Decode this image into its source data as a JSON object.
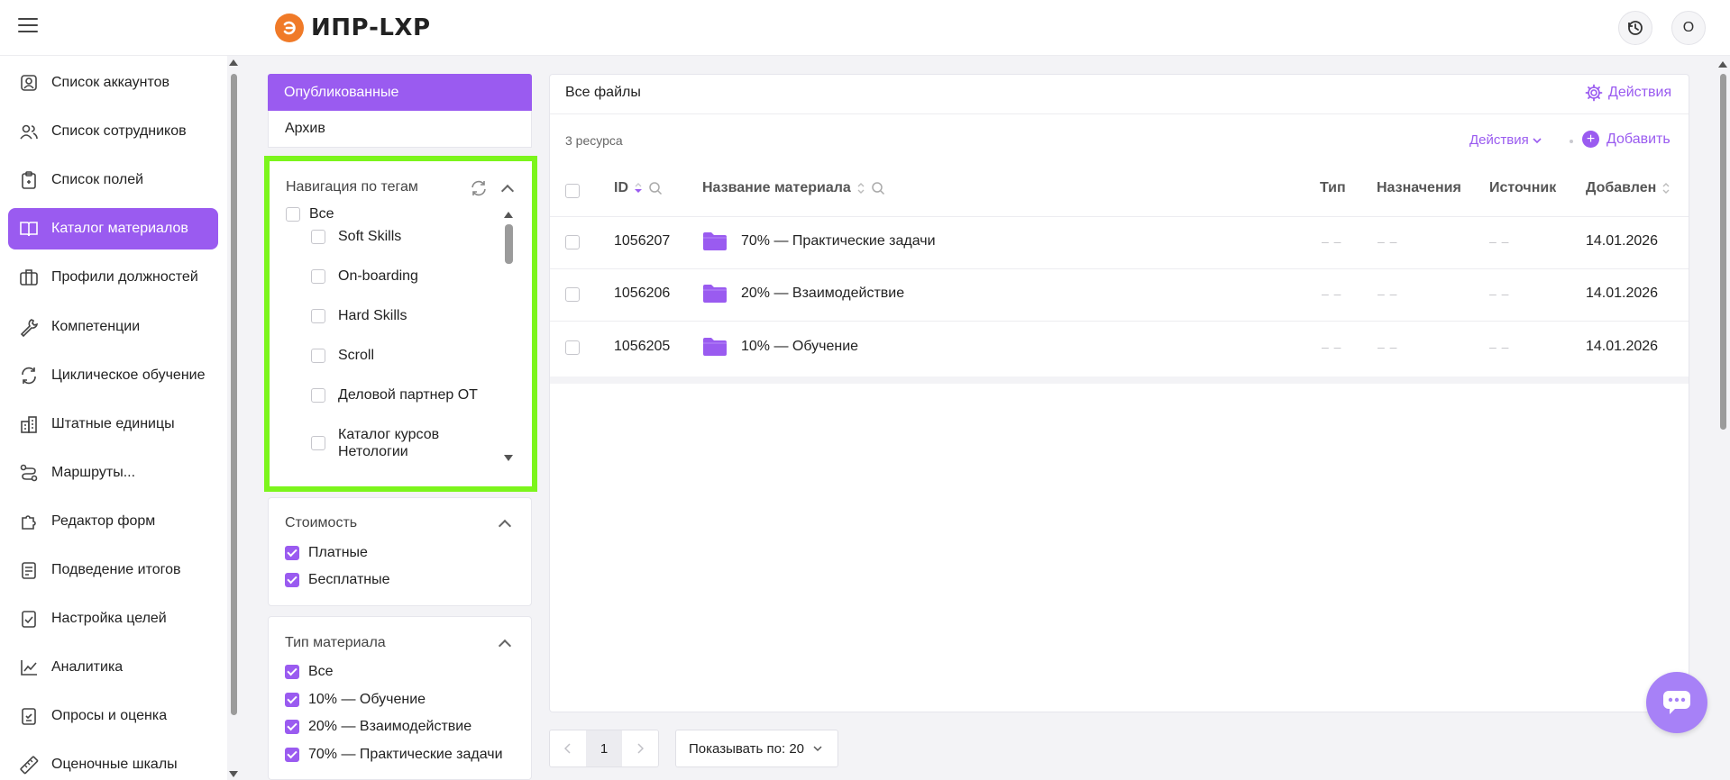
{
  "app": {
    "logo_text": "ИПР-LXP",
    "user_initial": "О"
  },
  "sidebar": {
    "items": [
      {
        "label": "Список аккаунтов",
        "icon": "account-box-icon"
      },
      {
        "label": "Список сотрудников",
        "icon": "users-icon"
      },
      {
        "label": "Список полей",
        "icon": "clipboard-icon"
      },
      {
        "label": "Каталог материалов",
        "icon": "book-icon",
        "active": true
      },
      {
        "label": "Профили должностей",
        "icon": "briefcase-icon"
      },
      {
        "label": "Компетенции",
        "icon": "wrench-icon"
      },
      {
        "label": "Циклическое обучение",
        "icon": "refresh-icon"
      },
      {
        "label": "Штатные единицы",
        "icon": "building-icon"
      },
      {
        "label": "Маршруты...",
        "icon": "route-icon"
      },
      {
        "label": "Редактор форм",
        "icon": "puzzle-icon"
      },
      {
        "label": "Подведение итогов",
        "icon": "report-icon"
      },
      {
        "label": "Настройка целей",
        "icon": "target-doc-icon"
      },
      {
        "label": "Аналитика",
        "icon": "chart-icon"
      },
      {
        "label": "Опросы и оценка",
        "icon": "survey-icon"
      },
      {
        "label": "Оценочные шкалы",
        "icon": "ruler-icon"
      }
    ]
  },
  "status_tabs": {
    "published": "Опубликованные",
    "archive": "Архив"
  },
  "tag_nav": {
    "title": "Навигация по тегам",
    "all_label": "Все",
    "tags": [
      "Soft Skills",
      "On-boarding",
      "Hard Skills",
      "Scroll",
      "Деловой партнер ОТ",
      "Каталог курсов\nНетологии"
    ]
  },
  "cost_filter": {
    "title": "Стоимость",
    "options": [
      {
        "label": "Платные",
        "checked": true
      },
      {
        "label": "Бесплатные",
        "checked": true
      }
    ]
  },
  "type_filter": {
    "title": "Тип материала",
    "options": [
      {
        "label": "Все",
        "checked": true
      },
      {
        "label": "10% — Обучение",
        "checked": true
      },
      {
        "label": "20% — Взаимодействие",
        "checked": true
      },
      {
        "label": "70% — Практические задачи",
        "checked": true
      }
    ]
  },
  "main": {
    "breadcrumb": "Все файлы",
    "actions_top": "Действия",
    "resource_count": "3 ресурса",
    "actions_dropdown": "Действия",
    "add_label": "Добавить",
    "columns": {
      "id": "ID",
      "name": "Название материала",
      "type": "Тип",
      "assignments": "Назначения",
      "source": "Источник",
      "added": "Добавлен"
    },
    "rows": [
      {
        "id": "1056207",
        "name": "70% — Практические задачи",
        "type": "– –",
        "assignments": "– –",
        "source": "– –",
        "added": "14.01.2026"
      },
      {
        "id": "1056206",
        "name": "20% — Взаимодействие",
        "type": "– –",
        "assignments": "– –",
        "source": "– –",
        "added": "14.01.2026"
      },
      {
        "id": "1056205",
        "name": "10% — Обучение",
        "type": "– –",
        "assignments": "– –",
        "source": "– –",
        "added": "14.01.2026"
      }
    ],
    "pagination": {
      "current_page": "1",
      "page_size_label": "Показывать по: 20"
    }
  },
  "colors": {
    "accent": "#9a5bf0",
    "highlight_border": "#7cf51c",
    "logo": "#f07a28"
  }
}
